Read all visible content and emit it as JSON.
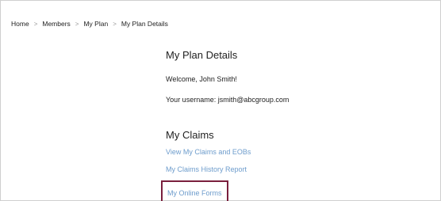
{
  "breadcrumb": {
    "items": [
      {
        "label": "Home"
      },
      {
        "label": "Members"
      },
      {
        "label": "My Plan"
      },
      {
        "label": "My Plan Details"
      }
    ],
    "separator": ">"
  },
  "main": {
    "title": "My Plan Details",
    "welcome": "Welcome, John Smith!",
    "username": "Your username: jsmith@abcgroup.com"
  },
  "claims": {
    "title": "My Claims",
    "links": [
      {
        "label": "View My Claims and EOBs"
      },
      {
        "label": "My Claims History Report"
      },
      {
        "label": "My Online Forms"
      }
    ]
  },
  "colors": {
    "link": "#6d9ccc",
    "highlight_border": "#7a1f3d",
    "text": "#222222"
  }
}
